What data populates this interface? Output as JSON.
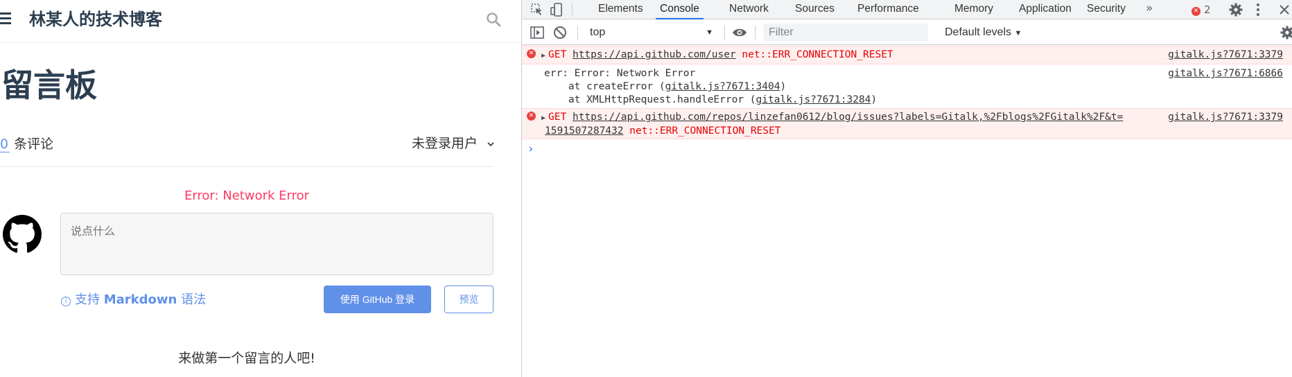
{
  "blog": {
    "site_title": "林某人的技术博客",
    "page_title": "留言板",
    "comment_count": "0",
    "comment_count_label": " 条评论",
    "user_menu": "未登录用户",
    "error": "Error: Network Error",
    "comment_placeholder": "说点什么",
    "markdown_tip": "支持",
    "markdown_tip_bold": "Markdown",
    "markdown_tip_end": "语法",
    "login_button": "使用 GitHub 登录",
    "preview_button": "预览",
    "first_comment": "来做第一个留言的人吧!"
  },
  "devtools": {
    "tabs": [
      "Elements",
      "Console",
      "Network",
      "Sources",
      "Performance",
      "Memory",
      "Application",
      "Security"
    ],
    "active_tab": "Console",
    "more": "»",
    "error_count": "2",
    "context": "top",
    "filter_placeholder": "Filter",
    "levels": "Default levels",
    "messages": [
      {
        "method": "GET",
        "url": "https://api.github.com/user",
        "error": "net::ERR_CONNECTION_RESET",
        "source": "gitalk.js?7671:3379"
      },
      {
        "line1": "err: Error: Network Error",
        "line2_pre": "    at createError (",
        "line2_link": "gitalk.js?7671:3404",
        "line2_post": ")",
        "line3_pre": "    at XMLHttpRequest.handleError (",
        "line3_link": "gitalk.js?7671:3284",
        "line3_post": ")",
        "source": "gitalk.js?7671:6866"
      },
      {
        "method": "GET",
        "url_line1": "https://api.github.com/repos/linzefan0612/blog/issues?labels=Gitalk,%2Fblogs%2FGitalk%2F&t=",
        "url_line2": "1591507287432",
        "error": "net::ERR_CONNECTION_RESET",
        "source": "gitalk.js?7671:3379"
      }
    ],
    "prompt": "›"
  },
  "colors": {
    "accent": "#6190e8",
    "error_text": "#ff3860",
    "console_error": "#e60000",
    "error_bg": "#fff0f0",
    "tab_underline": "#1a73e8"
  }
}
